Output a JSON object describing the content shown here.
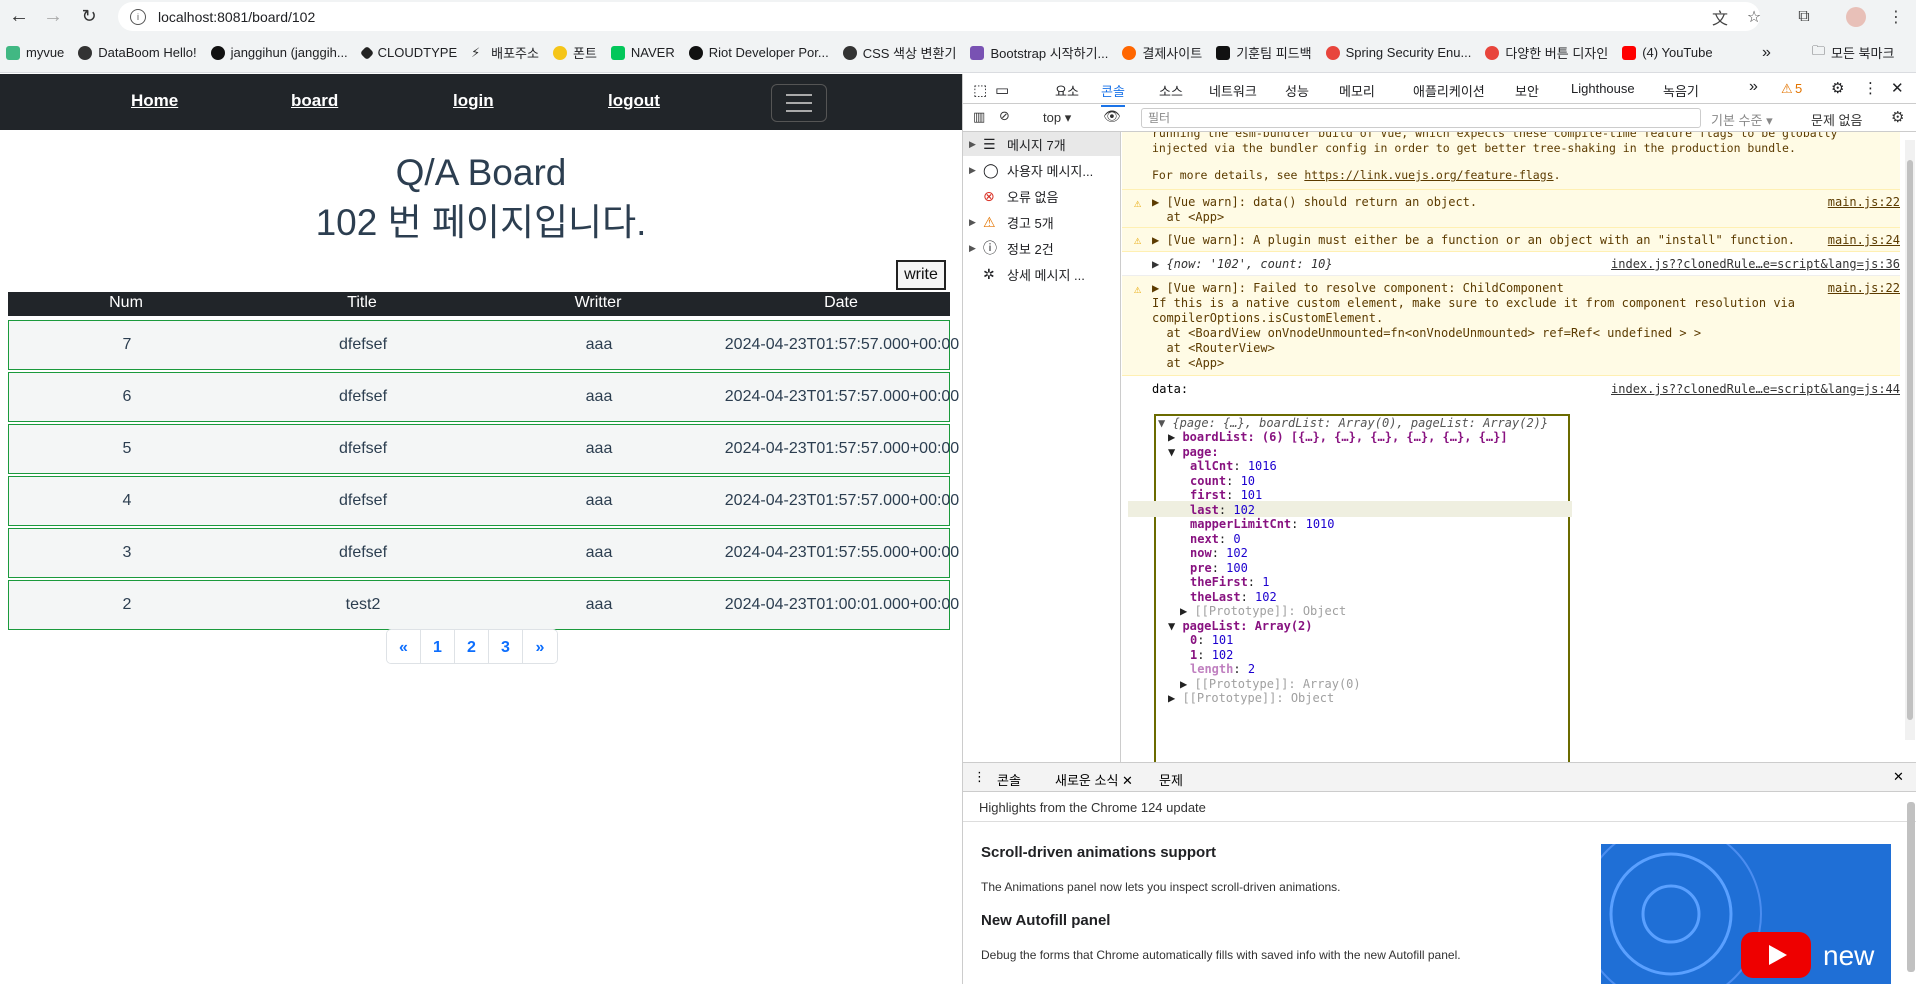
{
  "browser": {
    "url": "localhost:8081/board/102",
    "bookmarks": [
      "myvue",
      "DataBoom Hello!",
      "janggihun (janggih...",
      "CLOUDTYPE",
      "배포주소",
      "폰트",
      "NAVER",
      "Riot Developer Por...",
      "CSS 색상 변환기",
      "Bootstrap 시작하기...",
      "결제사이트",
      "기훈팀 피드백",
      "Spring Security Enu...",
      "다양한 버튼 디자인",
      "(4) YouTube"
    ],
    "bookmarks_overflow": "»",
    "all_bookmarks": "모든 북마크"
  },
  "app": {
    "nav": {
      "home": "Home",
      "board": "board",
      "login": "login",
      "logout": "logout"
    },
    "title_line1": "Q/A Board",
    "title_line2": "102 번 페이지입니다.",
    "write_label": "write",
    "table": {
      "headers": [
        "Num",
        "Title",
        "Writter",
        "Date"
      ],
      "rows": [
        [
          "7",
          "dfefsef",
          "aaa",
          "2024-04-23T01:57:57.000+00:00"
        ],
        [
          "6",
          "dfefsef",
          "aaa",
          "2024-04-23T01:57:57.000+00:00"
        ],
        [
          "5",
          "dfefsef",
          "aaa",
          "2024-04-23T01:57:57.000+00:00"
        ],
        [
          "4",
          "dfefsef",
          "aaa",
          "2024-04-23T01:57:57.000+00:00"
        ],
        [
          "3",
          "dfefsef",
          "aaa",
          "2024-04-23T01:57:55.000+00:00"
        ],
        [
          "2",
          "test2",
          "aaa",
          "2024-04-23T01:00:01.000+00:00"
        ]
      ]
    },
    "pagination": [
      "«",
      "1",
      "2",
      "3",
      "»"
    ]
  },
  "devtools": {
    "tabs": [
      "요소",
      "콘솔",
      "소스",
      "네트워크",
      "성능",
      "메모리",
      "애플리케이션",
      "보안",
      "Lighthouse",
      "녹음기"
    ],
    "more": "»",
    "warning_count": "5",
    "context": "top",
    "filter_placeholder": "필터",
    "level": "기본 수준",
    "issues": "문제 없음",
    "sidebar": [
      "메시지 7개",
      "사용자 메시지...",
      "오류 없음",
      "경고 5개",
      "정보 2건",
      "상세 메시지 ..."
    ],
    "console": {
      "line0": "running the esm-bundler build of Vue, which expects these compile-time feature flags to be globally",
      "line0b": "injected via the bundler config in order to get better tree-shaking in the production bundle.",
      "line0c": "For more details, see ",
      "line0c_link": "https://link.vuejs.org/feature-flags",
      "w1": "[Vue warn]: data() should return an object.",
      "w1b": "  at <App>",
      "w1src": "main.js:22",
      "w2": "[Vue warn]: A plugin must either be a function or an object with an \"install\" function.",
      "w2src": "main.js:24",
      "log1": "{now: '102', count: 10}",
      "log1src": "index.js??clonedRule…e=script&lang=js:36",
      "w3": "[Vue warn]: Failed to resolve component: ChildComponent",
      "w3b": "If this is a native custom element, make sure to exclude it from component resolution via",
      "w3c": "compilerOptions.isCustomElement.",
      "w3d": "  at <BoardView onVnodeUnmounted=fn<onVnodeUnmounted> ref=Ref< undefined > >",
      "w3e": "  at <RouterView>",
      "w3f": "  at <App>",
      "w3src": "main.js:22",
      "datalabel": "data:",
      "datasrc": "index.js??clonedRule…e=script&lang=js:44",
      "obj_summary": "{page: {…}, boardList: Array(0), pageList: Array(2)}",
      "boardList": "boardList: (6) [{…}, {…}, {…}, {…}, {…}, {…}]",
      "page_key": "page:",
      "page": [
        [
          "allCnt",
          "1016"
        ],
        [
          "count",
          "10"
        ],
        [
          "first",
          "101"
        ],
        [
          "last",
          "102"
        ],
        [
          "mapperLimitCnt",
          "1010"
        ],
        [
          "next",
          "0"
        ],
        [
          "now",
          "102"
        ],
        [
          "pre",
          "100"
        ],
        [
          "theFirst",
          "1"
        ],
        [
          "theLast",
          "102"
        ]
      ],
      "proto_obj": "[[Prototype]]: Object",
      "pageList_key": "pageList: Array(2)",
      "pageList": [
        [
          "0",
          "101"
        ],
        [
          "1",
          "102"
        ],
        [
          "length",
          "2"
        ]
      ],
      "proto_arr": "[[Prototype]]: Array(0)",
      "proto_root": "[[Prototype]]: Object"
    },
    "drawer_tabs": [
      "콘솔",
      "새로운 소식",
      "문제"
    ],
    "whatsnew": {
      "highlights": "Highlights from the Chrome 124 update",
      "h1": "Scroll-driven animations support",
      "p1": "The Animations panel now lets you inspect scroll-driven animations.",
      "h2": "New Autofill panel",
      "p2": "Debug the forms that Chrome automatically fills with saved info with the new Autofill panel.",
      "promo_text": "new"
    }
  }
}
